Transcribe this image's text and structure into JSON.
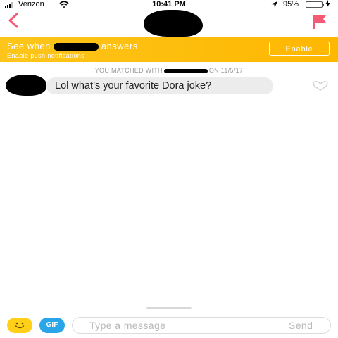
{
  "status_bar": {
    "carrier": "Verizon",
    "time": "10:41 PM",
    "battery": "95%",
    "battery_level": 0.95,
    "icons": [
      "signal-icon",
      "wifi-icon",
      "location-arrow-icon",
      "battery-icon",
      "charging-icon"
    ]
  },
  "nav": {
    "icons": [
      "back-icon",
      "flag-icon"
    ],
    "accent_color": "#f25a75"
  },
  "banner": {
    "title_before": "See when",
    "title_after": "answers",
    "subtitle": "Enable push notifications",
    "button_label": "Enable",
    "background_color": "#fdc51b"
  },
  "conversation": {
    "matched_prefix": "YOU MATCHED WITH",
    "matched_suffix": "ON 11/5/17",
    "messages": [
      {
        "text": "Lol what’s your favorite Dora joke?",
        "liked": false
      }
    ]
  },
  "composer": {
    "gif_label": "GIF",
    "placeholder": "Type a message",
    "send_label": "Send",
    "emoji_color": "#ffd017",
    "gif_color": "#2aa6e8"
  }
}
